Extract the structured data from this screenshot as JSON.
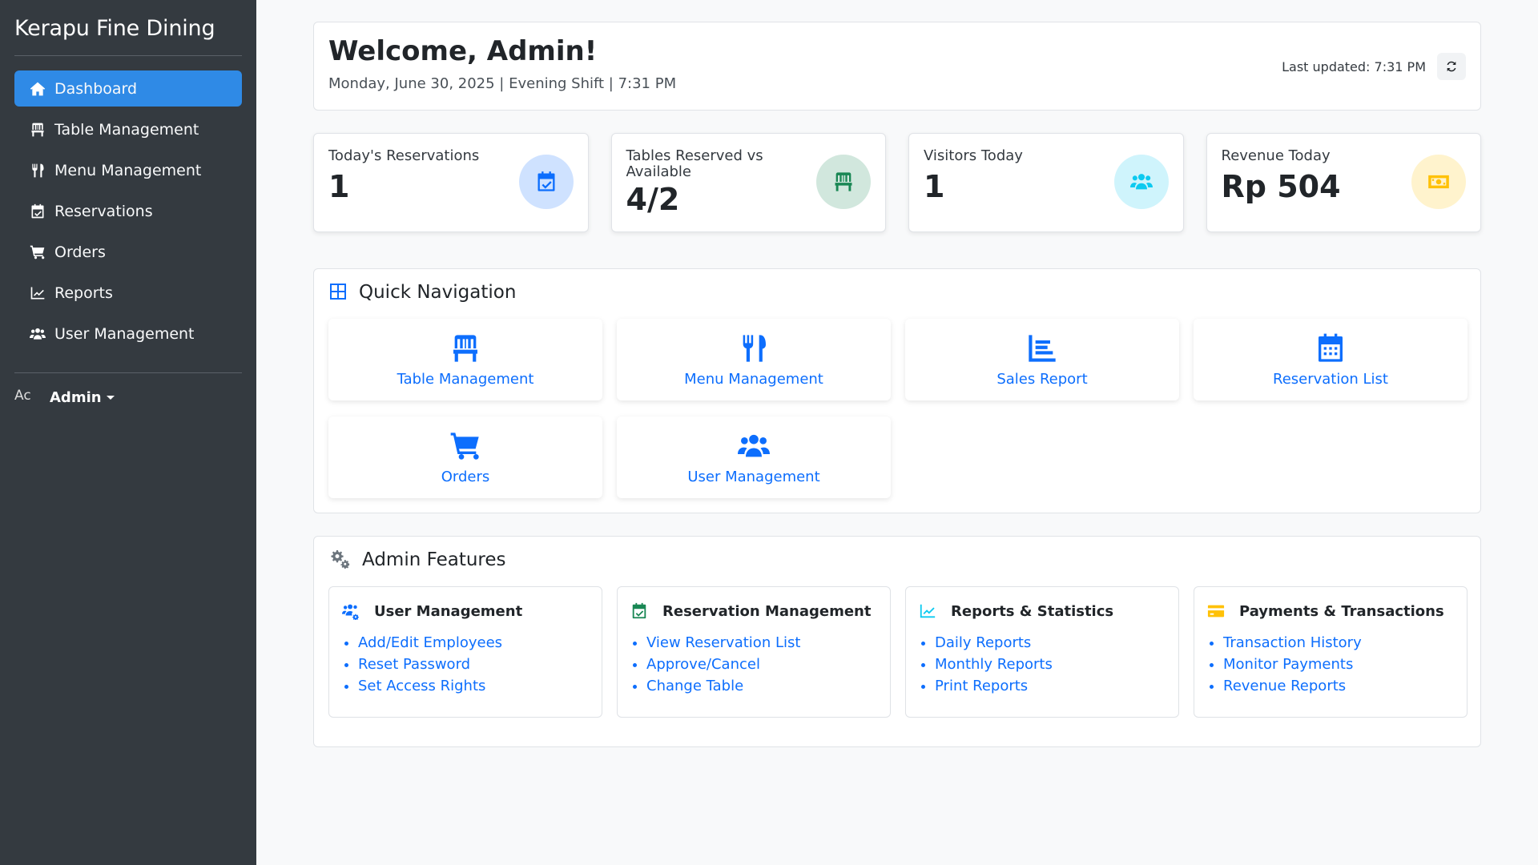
{
  "sidebar": {
    "brand": "Kerapu Fine Dining",
    "items": [
      {
        "label": "Dashboard",
        "icon": "home-icon",
        "active": true
      },
      {
        "label": "Table Management",
        "icon": "chair-icon"
      },
      {
        "label": "Menu Management",
        "icon": "utensils-icon"
      },
      {
        "label": "Reservations",
        "icon": "calendar-check-icon"
      },
      {
        "label": "Orders",
        "icon": "cart-icon"
      },
      {
        "label": "Reports",
        "icon": "chart-line-icon"
      },
      {
        "label": "User Management",
        "icon": "users-icon"
      }
    ],
    "user": {
      "avatar_alt": "Ac",
      "name": "Admin"
    }
  },
  "header": {
    "title": "Welcome, Admin!",
    "subtitle": "Monday, June 30, 2025 | Evening Shift | 7:31 PM",
    "last_updated": "Last updated: 7:31 PM"
  },
  "stats": [
    {
      "label": "Today's Reservations",
      "value": "1",
      "icon": "calendar-check-icon",
      "circle_color": "#cfe2ff",
      "icon_color": "#0d6efd"
    },
    {
      "label": "Tables Reserved vs Available",
      "value": "4/2",
      "icon": "chair-icon",
      "circle_color": "#d1e7dd",
      "icon_color": "#198754"
    },
    {
      "label": "Visitors Today",
      "value": "1",
      "icon": "users-icon",
      "circle_color": "#cff4fc",
      "icon_color": "#0dcaf0"
    },
    {
      "label": "Revenue Today",
      "value": "Rp 504",
      "icon": "money-bill-icon",
      "circle_color": "#fff3cd",
      "icon_color": "#ffc107"
    }
  ],
  "quick_nav": {
    "title": "Quick Navigation",
    "tiles": [
      {
        "label": "Table Management",
        "icon": "chair-icon"
      },
      {
        "label": "Menu Management",
        "icon": "utensils-icon"
      },
      {
        "label": "Sales Report",
        "icon": "chart-bar-icon"
      },
      {
        "label": "Reservation List",
        "icon": "calendar-icon"
      },
      {
        "label": "Orders",
        "icon": "cart-icon"
      },
      {
        "label": "User Management",
        "icon": "users-icon"
      }
    ]
  },
  "admin_features": {
    "title": "Admin Features",
    "cards": [
      {
        "title": "User Management",
        "icon": "users-cog-icon",
        "icon_color": "#0d6efd",
        "links": [
          "Add/Edit Employees",
          "Reset Password",
          "Set Access Rights"
        ]
      },
      {
        "title": "Reservation Management",
        "icon": "calendar-check-icon",
        "icon_color": "#198754",
        "links": [
          "View Reservation List",
          "Approve/Cancel",
          "Change Table"
        ]
      },
      {
        "title": "Reports & Statistics",
        "icon": "chart-line-icon",
        "icon_color": "#0dcaf0",
        "links": [
          "Daily Reports",
          "Monthly Reports",
          "Print Reports"
        ]
      },
      {
        "title": "Payments & Transactions",
        "icon": "credit-card-icon",
        "icon_color": "#ffc107",
        "links": [
          "Transaction History",
          "Monitor Payments",
          "Revenue Reports"
        ]
      }
    ]
  }
}
